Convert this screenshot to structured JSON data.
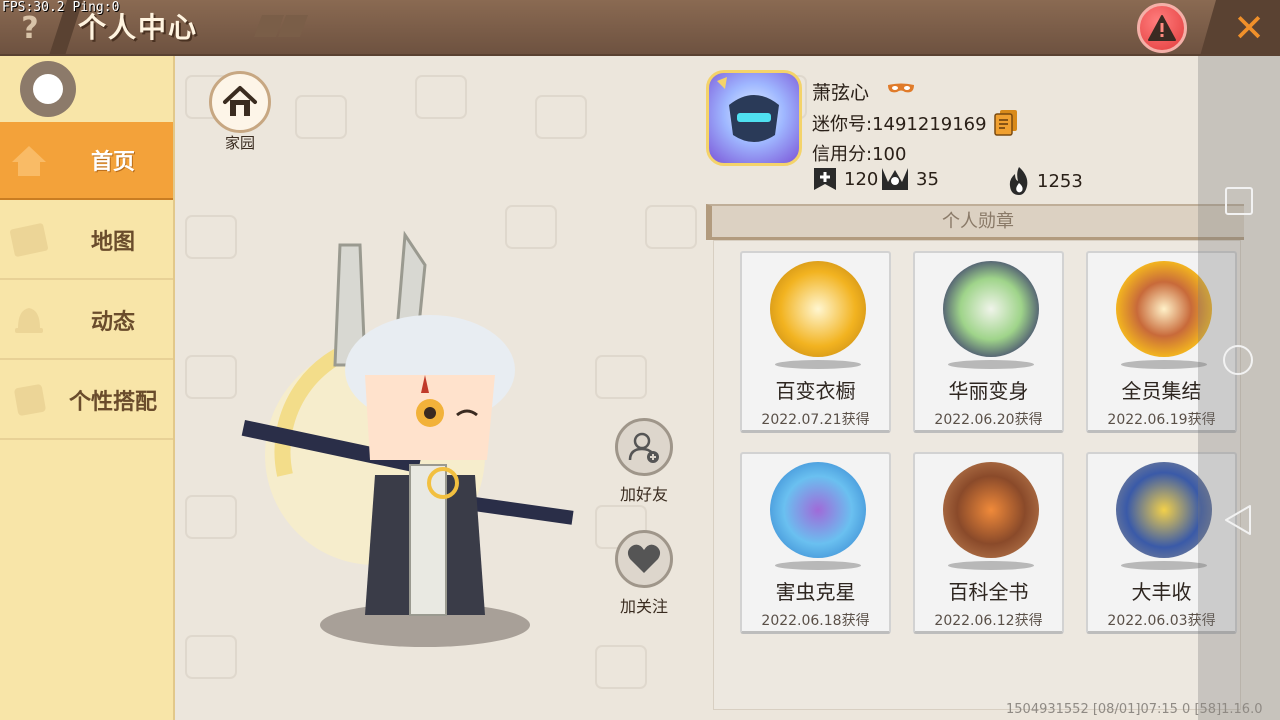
{
  "overlay": {
    "fps": "FPS:30.2",
    "ping": "Ping:0"
  },
  "header": {
    "help_label": "?",
    "title": "个人中心",
    "close_label": "✕"
  },
  "sidebar": {
    "items": [
      {
        "label": "首页",
        "icon": "home-tile-icon",
        "active": true
      },
      {
        "label": "地图",
        "icon": "map-icon",
        "active": false
      },
      {
        "label": "动态",
        "icon": "bell-icon",
        "active": false
      },
      {
        "label": "个性搭配",
        "icon": "costume-icon",
        "active": false
      }
    ]
  },
  "home": {
    "label": "家园"
  },
  "actions": {
    "add_friend": "加好友",
    "follow": "加关注"
  },
  "profile": {
    "name": "萧弦心",
    "id": "迷你号:1491219169",
    "credit": "信用分:100",
    "stats": [
      {
        "icon": "plus-flag-icon",
        "value": "120"
      },
      {
        "icon": "trophy-icon",
        "value": "35"
      },
      {
        "icon": "fire-icon",
        "value": "1253"
      }
    ]
  },
  "medals": {
    "header": "个人勋章",
    "items": [
      {
        "name": "百变衣橱",
        "date": "2022.07.21获得",
        "color": "#f2b320"
      },
      {
        "name": "华丽变身",
        "date": "2022.06.20获得",
        "color": "#6d7a99"
      },
      {
        "name": "全员集结",
        "date": "2022.06.19获得",
        "color": "#f2b320"
      },
      {
        "name": "害虫克星",
        "date": "2022.06.18获得",
        "color": "#4aa8e8"
      },
      {
        "name": "百科全书",
        "date": "2022.06.12获得",
        "color": "#b8794a"
      },
      {
        "name": "大丰收",
        "date": "2022.06.03获得",
        "color": "#6d7a99"
      }
    ]
  },
  "footer": {
    "info": "1504931552   [08/01]07:15 0   [58]1.16.0"
  },
  "colors": {
    "accent": "#f3a23a",
    "title_bar": "#7a5c46",
    "sidebar": "#f8e5a8",
    "warning": "#e23b3b"
  }
}
